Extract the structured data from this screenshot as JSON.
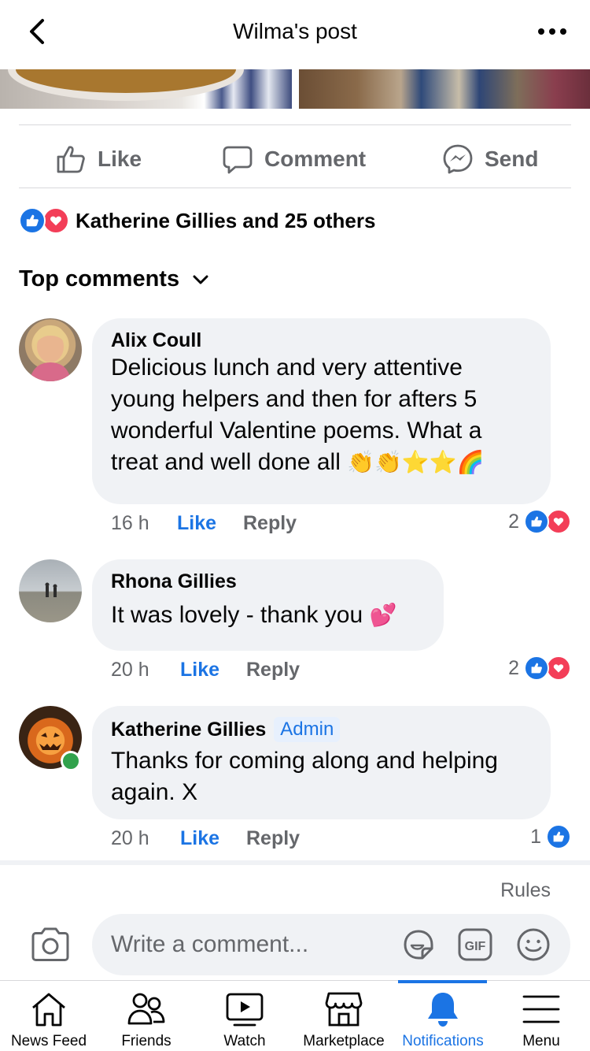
{
  "header": {
    "title": "Wilma's post",
    "back_icon": "chevron-left-icon",
    "more_icon": "more-horizontal-icon"
  },
  "actions": {
    "like": "Like",
    "comment": "Comment",
    "send": "Send"
  },
  "reactions": {
    "summary": "Katherine Gillies and 25 others"
  },
  "comments_header": {
    "label": "Top comments"
  },
  "comments": [
    {
      "name": "Alix Coull",
      "text": "Delicious lunch and very attentive young helpers and then for afters 5 wonderful Valentine poems. What a treat and well done all",
      "emoji": "👏👏⭐⭐🌈",
      "time": "16 h",
      "like": "Like",
      "reply": "Reply",
      "reaction_count": "2"
    },
    {
      "name": "Rhona Gillies",
      "text": "It was lovely - thank you",
      "emoji": "💕",
      "time": "20 h",
      "like": "Like",
      "reply": "Reply",
      "reaction_count": "2"
    },
    {
      "name": "Katherine Gillies",
      "badge": "Admin",
      "text": "Thanks for coming along and helping again. X",
      "time": "20 h",
      "like": "Like",
      "reply": "Reply",
      "reaction_count": "1"
    }
  ],
  "composer": {
    "rules": "Rules",
    "placeholder": "Write a comment..."
  },
  "tabs": [
    {
      "label": "News Feed",
      "icon": "home-icon"
    },
    {
      "label": "Friends",
      "icon": "friends-icon"
    },
    {
      "label": "Watch",
      "icon": "watch-icon"
    },
    {
      "label": "Marketplace",
      "icon": "marketplace-icon"
    },
    {
      "label": "Notifications",
      "icon": "bell-icon",
      "active": true
    },
    {
      "label": "Menu",
      "icon": "menu-icon"
    }
  ],
  "colors": {
    "accent": "#1b74e4",
    "love": "#f33e58",
    "muted": "#65676b",
    "bubble": "#f0f2f5",
    "online": "#31a24c"
  }
}
